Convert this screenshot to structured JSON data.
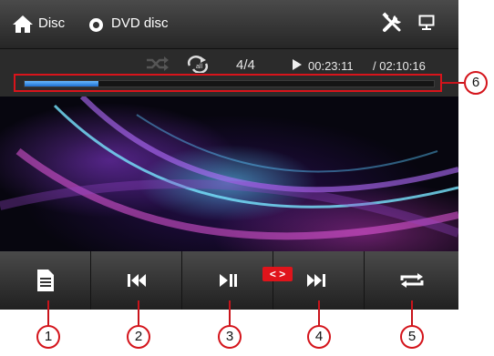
{
  "header": {
    "home_icon": "home-icon",
    "source_label": "Disc",
    "disc_label": "DVD disc",
    "settings_icon": "tools-icon",
    "display_icon": "monitor-icon"
  },
  "status": {
    "track": "4/4",
    "elapsed": "00:23:11",
    "total": "/ 02:10:16",
    "progress_fraction": 0.18
  },
  "controls": {
    "audio_channel_badge": "< >",
    "buttons": [
      "list-icon",
      "previous-icon",
      "play-pause-icon",
      "next-icon",
      "repeat-icon"
    ]
  },
  "callouts": [
    "1",
    "2",
    "3",
    "4",
    "5",
    "6"
  ],
  "colors": {
    "accent": "#d8141b",
    "progress": "#2f86e8"
  }
}
